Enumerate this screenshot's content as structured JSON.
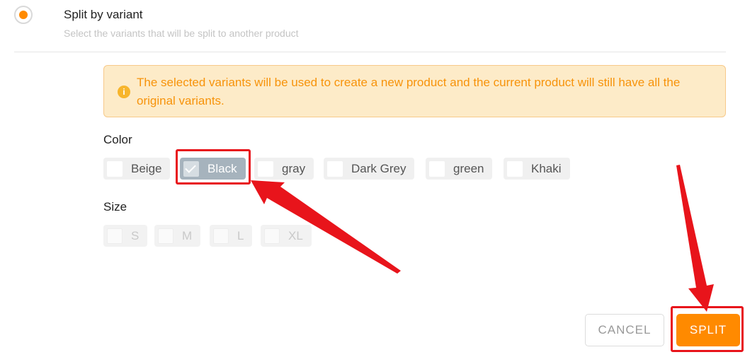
{
  "option": {
    "title": "Split by variant",
    "description": "Select the variants that will be split to another product",
    "selected": true
  },
  "alert": {
    "icon": "info-icon",
    "text": "The selected variants will be used to create a new product and the current product will still have all the original variants."
  },
  "color_group": {
    "label": "Color",
    "options": [
      {
        "label": "Beige",
        "checked": false
      },
      {
        "label": "Black",
        "checked": true
      },
      {
        "label": "gray",
        "checked": false
      },
      {
        "label": "Dark Grey",
        "checked": false
      },
      {
        "label": "green",
        "checked": false
      },
      {
        "label": "Khaki",
        "checked": false
      }
    ]
  },
  "size_group": {
    "label": "Size",
    "options": [
      {
        "label": "S",
        "disabled": true
      },
      {
        "label": "M",
        "disabled": true
      },
      {
        "label": "L",
        "disabled": true
      },
      {
        "label": "XL",
        "disabled": true
      }
    ]
  },
  "actions": {
    "cancel_label": "CANCEL",
    "split_label": "SPLIT"
  },
  "colors": {
    "accent": "#ff8a00",
    "alert_bg": "#fdebc8",
    "alert_text": "#f7930a",
    "annotation": "#e8141b",
    "checked_chip": "#a6b3bd"
  }
}
